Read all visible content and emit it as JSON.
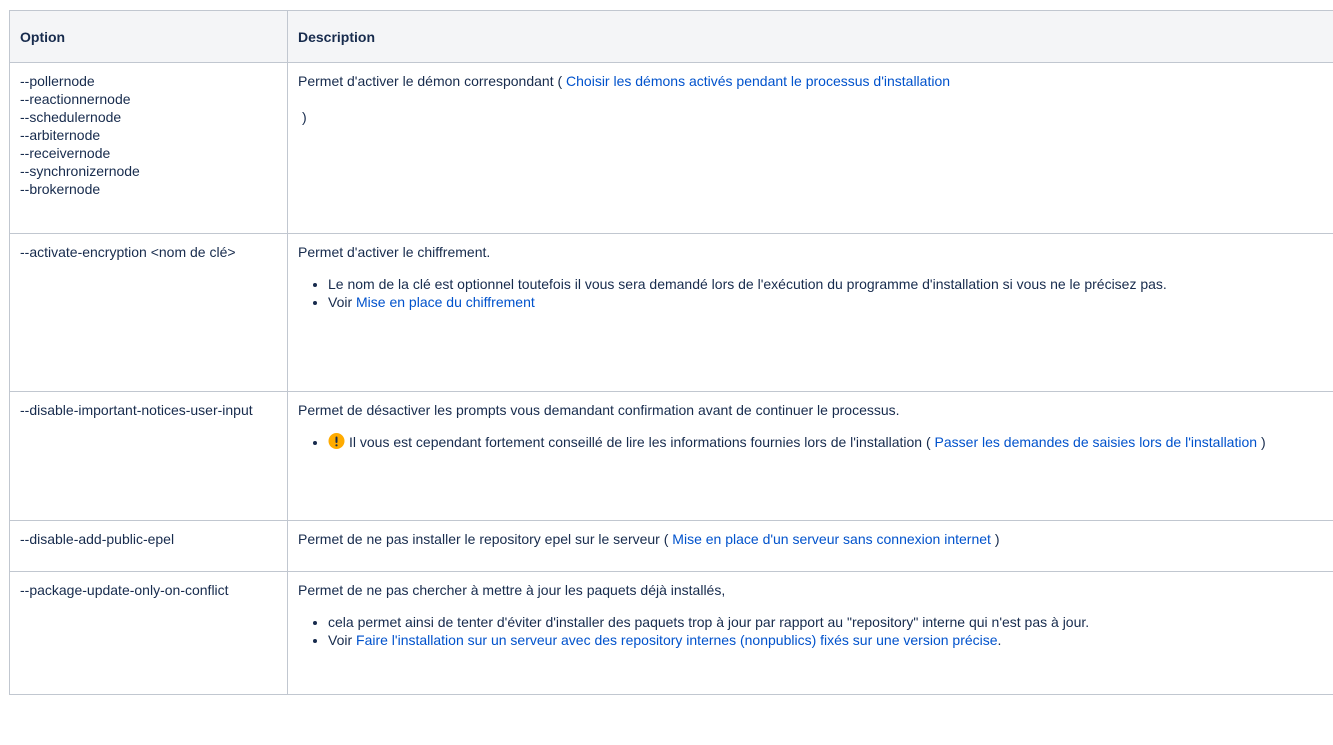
{
  "table": {
    "headers": {
      "option": "Option",
      "description": "Description"
    },
    "rows": [
      {
        "option_lines": [
          "--pollernode",
          "--reactionnernode",
          "--schedulernode",
          "--arbiternode",
          "--receivernode",
          "--synchronizernode",
          "--brokernode"
        ],
        "desc_text": "Permet d'activer le démon correspondant (",
        "desc_link": "Choisir les démons activés pendant le processus d'installation",
        "desc_close": ")"
      },
      {
        "option": "--activate-encryption <nom de clé>",
        "desc_text": "Permet d'activer le chiffrement.",
        "bullets": {
          "b1": "Le nom de la clé est optionnel toutefois il vous sera demandé lors de l'exécution du programme d'installation si vous ne le précisez pas.",
          "b2_prefix": "Voir",
          "b2_link": "Mise en place du chiffrement"
        }
      },
      {
        "option": "--disable-important-notices-user-input",
        "desc_text": "Permet de désactiver les prompts vous demandant confirmation avant de continuer le processus.",
        "bullet_icon": "warning-icon",
        "bullet_text": "Il vous est cependant fortement conseillé de lire les informations fournies lors de l'installation (",
        "bullet_link": "Passer les demandes de saisies lors de l'installation",
        "bullet_close": ")"
      },
      {
        "option": "--disable-add-public-epel",
        "desc_text": "Permet de ne pas installer le repository epel sur le serveur (",
        "desc_link": "Mise en place d'un serveur sans connexion internet",
        "desc_close": ")"
      },
      {
        "option": "--package-update-only-on-conflict",
        "desc_text": "Permet de ne pas chercher à mettre à jour les paquets déjà installés,",
        "bullets": {
          "b1": "cela permet ainsi de tenter d'éviter d'installer des paquets trop à jour par rapport au \"repository\" interne qui n'est pas à jour.",
          "b2_prefix": "Voir",
          "b2_link": "Faire l'installation sur un serveur avec des repository internes (nonpublics) fixés sur une version précise",
          "b2_suffix": "."
        }
      }
    ]
  },
  "colors": {
    "link": "#0052cc",
    "text": "#172b4d",
    "header_bg": "#f4f5f7",
    "border": "#c1c7d0",
    "warning": "#ffab00"
  }
}
